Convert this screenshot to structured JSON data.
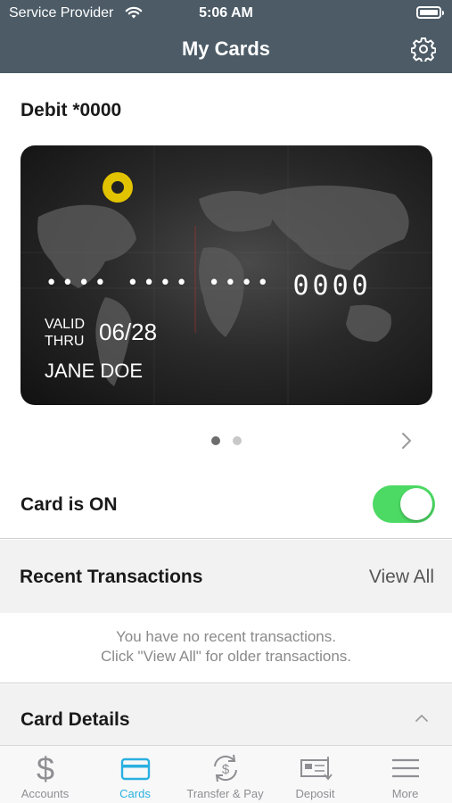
{
  "status_bar": {
    "carrier": "Service Provider",
    "time": "5:06 AM"
  },
  "header": {
    "title": "My Cards",
    "settings_icon": "gear-icon"
  },
  "card": {
    "name": "Debit *0000",
    "number_last4": "0000",
    "valid_label_line1": "VALID",
    "valid_label_line2": "THRU",
    "expiry": "06/28",
    "holder": "JANE DOE",
    "page_count": 2,
    "active_page": 1
  },
  "card_status": {
    "label": "Card is ON",
    "enabled": true
  },
  "transactions": {
    "heading": "Recent Transactions",
    "view_all": "View All",
    "empty_line1": "You have no recent transactions.",
    "empty_line2": "Click \"View All\" for older transactions."
  },
  "details": {
    "heading": "Card Details"
  },
  "tabs": [
    {
      "label": "Accounts",
      "icon": "dollar-icon",
      "active": false
    },
    {
      "label": "Cards",
      "icon": "card-icon",
      "active": true
    },
    {
      "label": "Transfer & Pay",
      "icon": "transfer-icon",
      "active": false
    },
    {
      "label": "Deposit",
      "icon": "deposit-icon",
      "active": false
    },
    {
      "label": "More",
      "icon": "menu-icon",
      "active": false
    }
  ],
  "colors": {
    "header_bg": "#4c5b66",
    "toggle_on": "#4cd964",
    "tab_active": "#2ab0e0",
    "tab_inactive": "#8e8e93"
  }
}
